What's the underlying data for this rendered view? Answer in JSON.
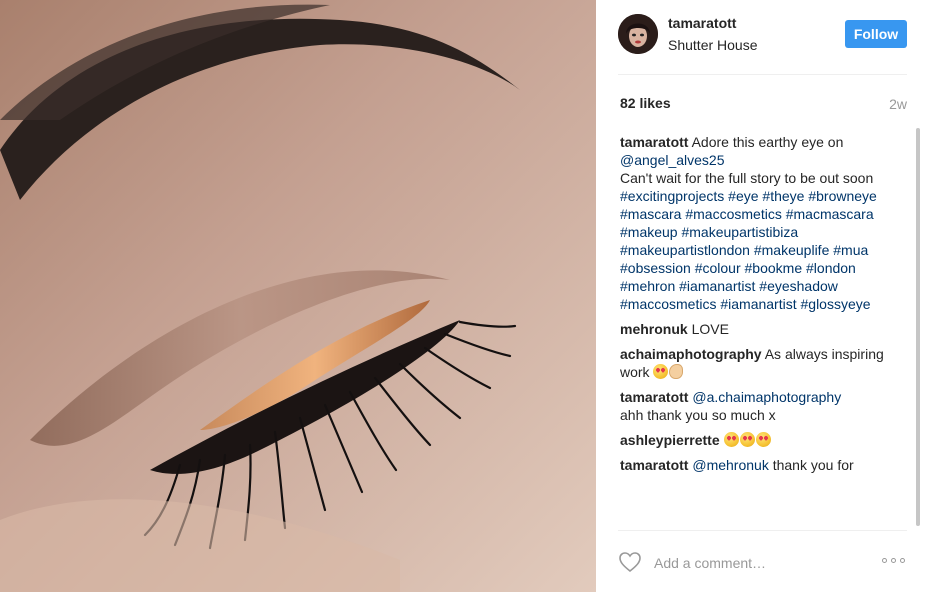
{
  "post": {
    "username": "tamaratott",
    "location": "Shutter House",
    "follow_label": "Follow",
    "likes": "82 likes",
    "age": "2w",
    "photo_icon": "eye-makeup-photo"
  },
  "caption": {
    "user": "tamaratott",
    "text1": "Adore this earthy eye on",
    "mention": "@angel_alves25",
    "text2": "Can't wait for the full story to be out soon",
    "tags": "#excitingprojects #eye #theye #browneye #mascara #maccosmetics #macmascara #makeup #makeupartistibiza #makeupartistlondon #makeuplife #mua #obsession #colour #bookme #london #mehron #iamanartist #eyeshadow #maccosmetics #iamanartist #glossyeye"
  },
  "comments": [
    {
      "user": "mehronuk",
      "text": "LOVE",
      "mention": ""
    },
    {
      "user": "achaimaphotography",
      "text": "As always inspiring work",
      "mention": "",
      "emoji": "heart-eyes clap"
    },
    {
      "user": "tamaratott",
      "mention": "@a.chaimaphotography",
      "text": "ahh thank you so much x"
    },
    {
      "user": "ashleypierrette",
      "text": "",
      "mention": "",
      "emoji": "heart-eyes x3"
    },
    {
      "user": "tamaratott",
      "mention": "@mehronuk",
      "text": "thank you for"
    }
  ],
  "composer": {
    "placeholder": "Add a comment…",
    "like_icon": "heart-icon",
    "more_icon": "more-options-icon"
  },
  "colors": {
    "follow_bg": "#3897f0",
    "link": "#003569",
    "muted": "#999999"
  }
}
